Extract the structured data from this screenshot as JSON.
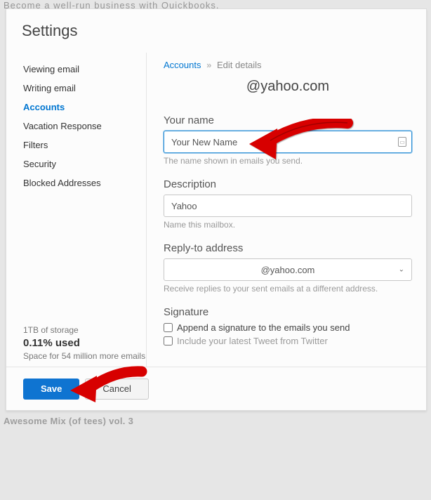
{
  "background": {
    "top_text": "Become a well-run business with Quickbooks.",
    "bottom_text": "Awesome Mix (of tees) vol. 3"
  },
  "panel": {
    "title": "Settings"
  },
  "sidebar": {
    "items": [
      {
        "label": "Viewing email"
      },
      {
        "label": "Writing email"
      },
      {
        "label": "Accounts"
      },
      {
        "label": "Vacation Response"
      },
      {
        "label": "Filters"
      },
      {
        "label": "Security"
      },
      {
        "label": "Blocked Addresses"
      }
    ],
    "active_index": 2
  },
  "storage": {
    "total": "1TB of storage",
    "used": "0.11% used",
    "remaining": "Space for 54 million more emails"
  },
  "breadcrumb": {
    "root": "Accounts",
    "sep": "»",
    "leaf": "Edit details"
  },
  "email_display": "@yahoo.com",
  "fields": {
    "name": {
      "label": "Your name",
      "value": "Your New Name",
      "hint": "The name shown in emails you send."
    },
    "description": {
      "label": "Description",
      "value": "Yahoo",
      "hint": "Name this mailbox."
    },
    "reply_to": {
      "label": "Reply-to address",
      "value": "@yahoo.com",
      "hint": "Receive replies to your sent emails at a different address."
    },
    "signature": {
      "label": "Signature",
      "append": "Append a signature to the emails you send",
      "tweet": "Include your latest Tweet from Twitter"
    }
  },
  "footer": {
    "save": "Save",
    "cancel": "Cancel"
  }
}
